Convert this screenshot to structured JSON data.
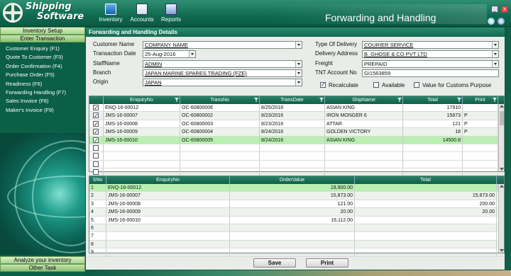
{
  "app": {
    "logo_line1": "Shipping",
    "logo_line2": "Software",
    "title": "Forwarding and Handling",
    "accent": "#0f6a50",
    "selected_row_color": "#b9efb1"
  },
  "toolbar": {
    "inventory_label": "Inventory",
    "accounts_label": "Accounts",
    "reports_label": "Reports"
  },
  "sidebar": {
    "inventory_setup": "Inventory Setup",
    "enter_transaction": "Enter Transaction",
    "items": [
      "Customer Enquiry (F1)",
      "Quote To Customer (F3)",
      "Order Confirmation (F4)",
      "Purchase Order (F5)",
      "Readiness (F6)",
      "Forwarding Handling (F7)",
      "Sales Invoice (F8)",
      "Maker's Invoice (F9)"
    ],
    "analyze_inventory": "Analyze your inventory",
    "other_task": "Other Task"
  },
  "form": {
    "section_title": "Forwarding and Handling  Details",
    "customer_name_label": "Customer Name",
    "customer_name": "COMPANY NAME",
    "transaction_date_label": "Transaction Date",
    "transaction_date": "25-Aug-2016",
    "staffname_label": "StaffName",
    "staffname": "ADMIN",
    "branch_label": "Branch",
    "branch": "JAPAN MARINE SPARES TRADING (FZE)",
    "origin_label": "Origin",
    "origin": "JAPAN",
    "type_of_delivery_label": "Type Of Delivery",
    "type_of_delivery": "COURIER SERVICE",
    "delivery_address_label": "Delivery Address",
    "delivery_address": "B. GHOSE & CO PVT LTD",
    "freight_label": "Freight",
    "freight": "PREPAID",
    "tnt_label": "TNT Account No",
    "tnt": "GI1563859",
    "recalculate_label": "Recalculate",
    "recalculate_checked": true,
    "available_label": "Available",
    "available_checked": false,
    "customs_label": "Value for Customs Purpose",
    "customs_checked": false
  },
  "upper_grid": {
    "columns": [
      "EnquiryNo",
      "TransNo",
      "TransDate",
      "ShipName",
      "Total",
      "Print"
    ],
    "rows": [
      {
        "checked": true,
        "enquiry": "ENQ-16-00012",
        "trans": "OC-60800006",
        "date": "8/25/2016",
        "ship": "ASIAN KING",
        "total": "17910",
        "print": ""
      },
      {
        "checked": true,
        "enquiry": "JMS-16-00007",
        "trans": "OC-60800002",
        "date": "8/23/2016",
        "ship": "IRON MONGER 6",
        "total": "15873",
        "print": "P"
      },
      {
        "checked": true,
        "enquiry": "JMS-16-00008",
        "trans": "OC-60800003",
        "date": "8/23/2016",
        "ship": "ATTAR",
        "total": "121",
        "print": "P"
      },
      {
        "checked": true,
        "enquiry": "JMS-16-00009",
        "trans": "OC-60800004",
        "date": "8/24/2016",
        "ship": "GOLDEN VICTORY",
        "total": "18",
        "print": "P"
      },
      {
        "checked": true,
        "enquiry": "JMS-16-00010",
        "trans": "OC-60800005",
        "date": "8/24/2016",
        "ship": "ASIAN KING",
        "total": "14500.8",
        "print": ""
      }
    ],
    "empty_rows": 5
  },
  "lower_grid": {
    "columns": [
      "SNo",
      "EnquiryNo",
      "OrderValue",
      "Total"
    ],
    "rows": [
      {
        "sno": "1",
        "enquiry": "ENQ-16-00012",
        "order": "19,900.00",
        "total": ""
      },
      {
        "sno": "2",
        "enquiry": "JMS-16-00007",
        "order": "15,873.00",
        "total": "15,873.00"
      },
      {
        "sno": "3",
        "enquiry": "JMS-16-00008",
        "order": "121.00",
        "total": "200.00"
      },
      {
        "sno": "4",
        "enquiry": "JMS-16-00009",
        "order": "20.00",
        "total": "20.00"
      },
      {
        "sno": "5",
        "enquiry": "JMS-16-00010",
        "order": "16,112.00",
        "total": ""
      },
      {
        "sno": "6",
        "enquiry": "",
        "order": "",
        "total": ""
      },
      {
        "sno": "7",
        "enquiry": "",
        "order": "",
        "total": ""
      },
      {
        "sno": "8",
        "enquiry": "",
        "order": "",
        "total": ""
      },
      {
        "sno": "9",
        "enquiry": "",
        "order": "",
        "total": ""
      }
    ]
  },
  "buttons": {
    "save": "Save",
    "print": "Print"
  },
  "icons": {
    "logo": "ship-wheel-icon",
    "inventory": "inventory-icon",
    "accounts": "accounts-icon",
    "reports": "reports-icon",
    "help": "help-icon",
    "settings": "settings-icon"
  }
}
